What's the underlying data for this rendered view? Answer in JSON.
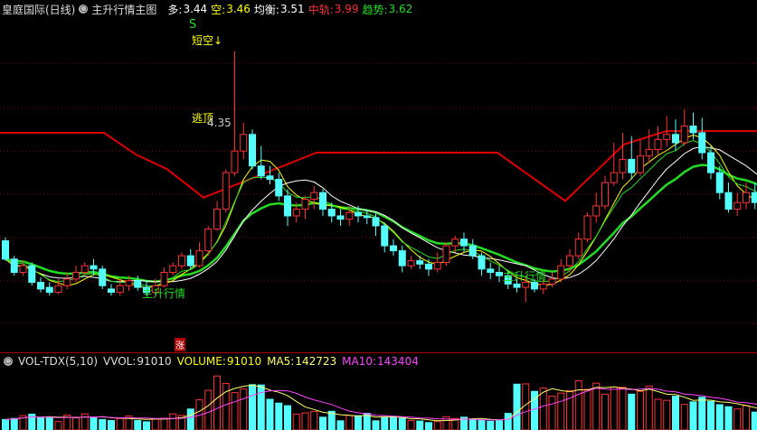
{
  "header": {
    "stock_name": "皇庭国际(日线)",
    "indicator_name": "主升行情主图",
    "duo_label": "多:",
    "duo_value": "3.44",
    "kong_label": "空:",
    "kong_value": "3.46",
    "junheng_label": "均衡:",
    "junheng_value": "3.51",
    "zhonggui_label": "中轨:",
    "zhonggui_value": "3.99",
    "qushi_label": "趋势:",
    "qushi_value": "3.62"
  },
  "annotations": {
    "s_marker": "S",
    "duan_kong": "短空↓",
    "tao_ding": "逃顶",
    "high_price": "4.35",
    "zhusheng_1": "主升行情",
    "zhusheng_2": "主升行情",
    "zhang_badge": "涨"
  },
  "volume_header": {
    "name": "VOL-TDX(5,10)",
    "vvol_label": "VVOL:",
    "vvol_value": "91010",
    "volume_label": "VOLUME:",
    "volume_value": "91010",
    "ma5_label": "MA5:",
    "ma5_value": "142723",
    "ma10_label": "MA10:",
    "ma10_value": "143404"
  },
  "colors": {
    "up": "#ff3232",
    "down": "#54ffff",
    "red_line": "#e00000",
    "green_line": "#22dd22",
    "white": "#ffffff",
    "yellow": "#ffff00",
    "ma5": "#ffff66",
    "ma10": "#ff44ff",
    "grid": "#8b0000"
  },
  "chart_data": {
    "type": "candlestick",
    "candles": [
      [
        3.21,
        3.1,
        3.23,
        3.09
      ],
      [
        3.1,
        3.02,
        3.12,
        3.0
      ],
      [
        3.02,
        3.06,
        3.09,
        3.0
      ],
      [
        3.06,
        2.96,
        3.08,
        2.94
      ],
      [
        2.96,
        2.92,
        2.99,
        2.9
      ],
      [
        2.93,
        2.9,
        2.96,
        2.88
      ],
      [
        2.9,
        2.94,
        2.98,
        2.89
      ],
      [
        2.94,
        2.98,
        3.02,
        2.92
      ],
      [
        2.98,
        3.02,
        3.06,
        2.96
      ],
      [
        3.02,
        3.06,
        3.08,
        3.0
      ],
      [
        3.06,
        3.04,
        3.1,
        3.0
      ],
      [
        3.04,
        2.94,
        3.06,
        2.92
      ],
      [
        2.92,
        2.9,
        2.95,
        2.88
      ],
      [
        2.9,
        2.94,
        2.98,
        2.88
      ],
      [
        2.94,
        2.97,
        3.0,
        2.91
      ],
      [
        2.97,
        2.93,
        3.0,
        2.91
      ],
      [
        2.93,
        2.9,
        2.97,
        2.88
      ],
      [
        2.9,
        2.94,
        2.98,
        2.88
      ],
      [
        2.94,
        3.02,
        3.05,
        2.93
      ],
      [
        3.02,
        3.06,
        3.08,
        3.0
      ],
      [
        3.06,
        3.12,
        3.14,
        3.04
      ],
      [
        3.12,
        3.06,
        3.16,
        3.04
      ],
      [
        3.06,
        3.15,
        3.2,
        3.05
      ],
      [
        3.15,
        3.28,
        3.3,
        3.12
      ],
      [
        3.28,
        3.4,
        3.45,
        3.27
      ],
      [
        3.4,
        3.62,
        3.64,
        3.38
      ],
      [
        3.62,
        3.75,
        4.35,
        3.6
      ],
      [
        3.75,
        3.85,
        3.92,
        3.7
      ],
      [
        3.85,
        3.66,
        3.88,
        3.64
      ],
      [
        3.66,
        3.6,
        3.78,
        3.58
      ],
      [
        3.6,
        3.58,
        3.66,
        3.55
      ],
      [
        3.58,
        3.48,
        3.62,
        3.45
      ],
      [
        3.48,
        3.36,
        3.52,
        3.3
      ],
      [
        3.36,
        3.4,
        3.44,
        3.32
      ],
      [
        3.4,
        3.46,
        3.48,
        3.34
      ],
      [
        3.46,
        3.5,
        3.54,
        3.4
      ],
      [
        3.5,
        3.4,
        3.52,
        3.36
      ],
      [
        3.4,
        3.36,
        3.44,
        3.32
      ],
      [
        3.36,
        3.34,
        3.4,
        3.3
      ],
      [
        3.34,
        3.38,
        3.42,
        3.3
      ],
      [
        3.38,
        3.36,
        3.42,
        3.32
      ],
      [
        3.36,
        3.35,
        3.4,
        3.31
      ],
      [
        3.35,
        3.3,
        3.38,
        3.24
      ],
      [
        3.3,
        3.18,
        3.32,
        3.14
      ],
      [
        3.18,
        3.15,
        3.22,
        3.12
      ],
      [
        3.15,
        3.06,
        3.18,
        3.02
      ],
      [
        3.06,
        3.09,
        3.12,
        3.04
      ],
      [
        3.09,
        3.07,
        3.12,
        3.04
      ],
      [
        3.07,
        3.04,
        3.1,
        3.0
      ],
      [
        3.04,
        3.08,
        3.14,
        3.02
      ],
      [
        3.08,
        3.18,
        3.2,
        3.06
      ],
      [
        3.18,
        3.22,
        3.24,
        3.14
      ],
      [
        3.22,
        3.18,
        3.26,
        3.14
      ],
      [
        3.18,
        3.12,
        3.22,
        3.1
      ],
      [
        3.12,
        3.04,
        3.14,
        3.0
      ],
      [
        3.04,
        3.02,
        3.08,
        2.98
      ],
      [
        3.02,
        3.0,
        3.06,
        2.96
      ],
      [
        3.0,
        2.95,
        3.03,
        2.92
      ],
      [
        2.95,
        2.93,
        2.98,
        2.9
      ],
      [
        2.93,
        2.96,
        2.99,
        2.84
      ],
      [
        2.96,
        2.92,
        2.98,
        2.9
      ],
      [
        2.92,
        2.95,
        2.98,
        2.89
      ],
      [
        2.95,
        2.98,
        3.02,
        2.93
      ],
      [
        2.98,
        3.06,
        3.1,
        2.96
      ],
      [
        3.06,
        3.12,
        3.16,
        3.02
      ],
      [
        3.12,
        3.22,
        3.26,
        3.1
      ],
      [
        3.22,
        3.36,
        3.38,
        3.2
      ],
      [
        3.36,
        3.42,
        3.5,
        3.32
      ],
      [
        3.42,
        3.56,
        3.6,
        3.4
      ],
      [
        3.56,
        3.62,
        3.8,
        3.54
      ],
      [
        3.62,
        3.7,
        3.86,
        3.58
      ],
      [
        3.7,
        3.62,
        3.84,
        3.58
      ],
      [
        3.62,
        3.72,
        3.82,
        3.6
      ],
      [
        3.72,
        3.76,
        3.88,
        3.68
      ],
      [
        3.76,
        3.82,
        3.9,
        3.72
      ],
      [
        3.82,
        3.85,
        3.96,
        3.78
      ],
      [
        3.85,
        3.8,
        3.94,
        3.75
      ],
      [
        3.8,
        3.9,
        4.0,
        3.78
      ],
      [
        3.9,
        3.86,
        3.98,
        3.82
      ],
      [
        3.86,
        3.74,
        3.95,
        3.7
      ],
      [
        3.74,
        3.62,
        3.78,
        3.58
      ],
      [
        3.62,
        3.5,
        3.66,
        3.46
      ],
      [
        3.5,
        3.4,
        3.56,
        3.38
      ],
      [
        3.4,
        3.44,
        3.5,
        3.36
      ],
      [
        3.44,
        3.5,
        3.56,
        3.4
      ],
      [
        3.5,
        3.44,
        3.56,
        3.4
      ],
      [
        3.44,
        3.36,
        3.48,
        3.32
      ],
      [
        3.36,
        3.3,
        3.38,
        3.26
      ],
      [
        3.3,
        3.34,
        3.38,
        3.28
      ],
      [
        3.34,
        3.2,
        3.36,
        3.16
      ],
      [
        3.2,
        3.18,
        3.24,
        3.14
      ],
      [
        3.18,
        3.14,
        3.22,
        3.1
      ]
    ],
    "volume": [
      41,
      45,
      56,
      62,
      47,
      51,
      33,
      58,
      50,
      63,
      47,
      41,
      37,
      45,
      55,
      37,
      32,
      44,
      46,
      63,
      57,
      82,
      118,
      155,
      211,
      182,
      146,
      160,
      177,
      176,
      120,
      105,
      95,
      62,
      67,
      72,
      50,
      73,
      36,
      57,
      56,
      65,
      36,
      48,
      52,
      46,
      37,
      35,
      29,
      33,
      52,
      45,
      50,
      40,
      37,
      34,
      36,
      65,
      179,
      180,
      151,
      164,
      132,
      144,
      154,
      192,
      159,
      183,
      140,
      168,
      167,
      140,
      151,
      172,
      120,
      116,
      132,
      100,
      110,
      128,
      112,
      99,
      91,
      82,
      95,
      70,
      62,
      67,
      51,
      48,
      38,
      44
    ]
  }
}
